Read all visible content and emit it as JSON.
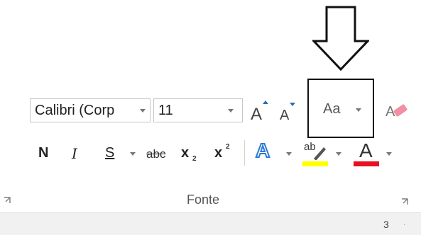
{
  "ribbon": {
    "font_name": "Calibri (Corp",
    "font_size": "11",
    "change_case_label": "Aa",
    "bold_label": "N",
    "italic_label": "I",
    "underline_label": "S",
    "strike_label": "abc",
    "subscript_base": "x",
    "subscript_mark": "2",
    "superscript_base": "x",
    "superscript_mark": "2",
    "text_effects_label": "A",
    "highlight_label": "ab",
    "font_color_label": "A",
    "group_label": "Fonte",
    "highlight_color": "#ffff00",
    "font_color": "#e81123"
  },
  "status": {
    "page_number": "3"
  },
  "icons": [
    "arrow-down-outline-icon",
    "grow-font-icon",
    "shrink-font-icon",
    "clear-formatting-icon",
    "dialog-launcher-icon"
  ]
}
